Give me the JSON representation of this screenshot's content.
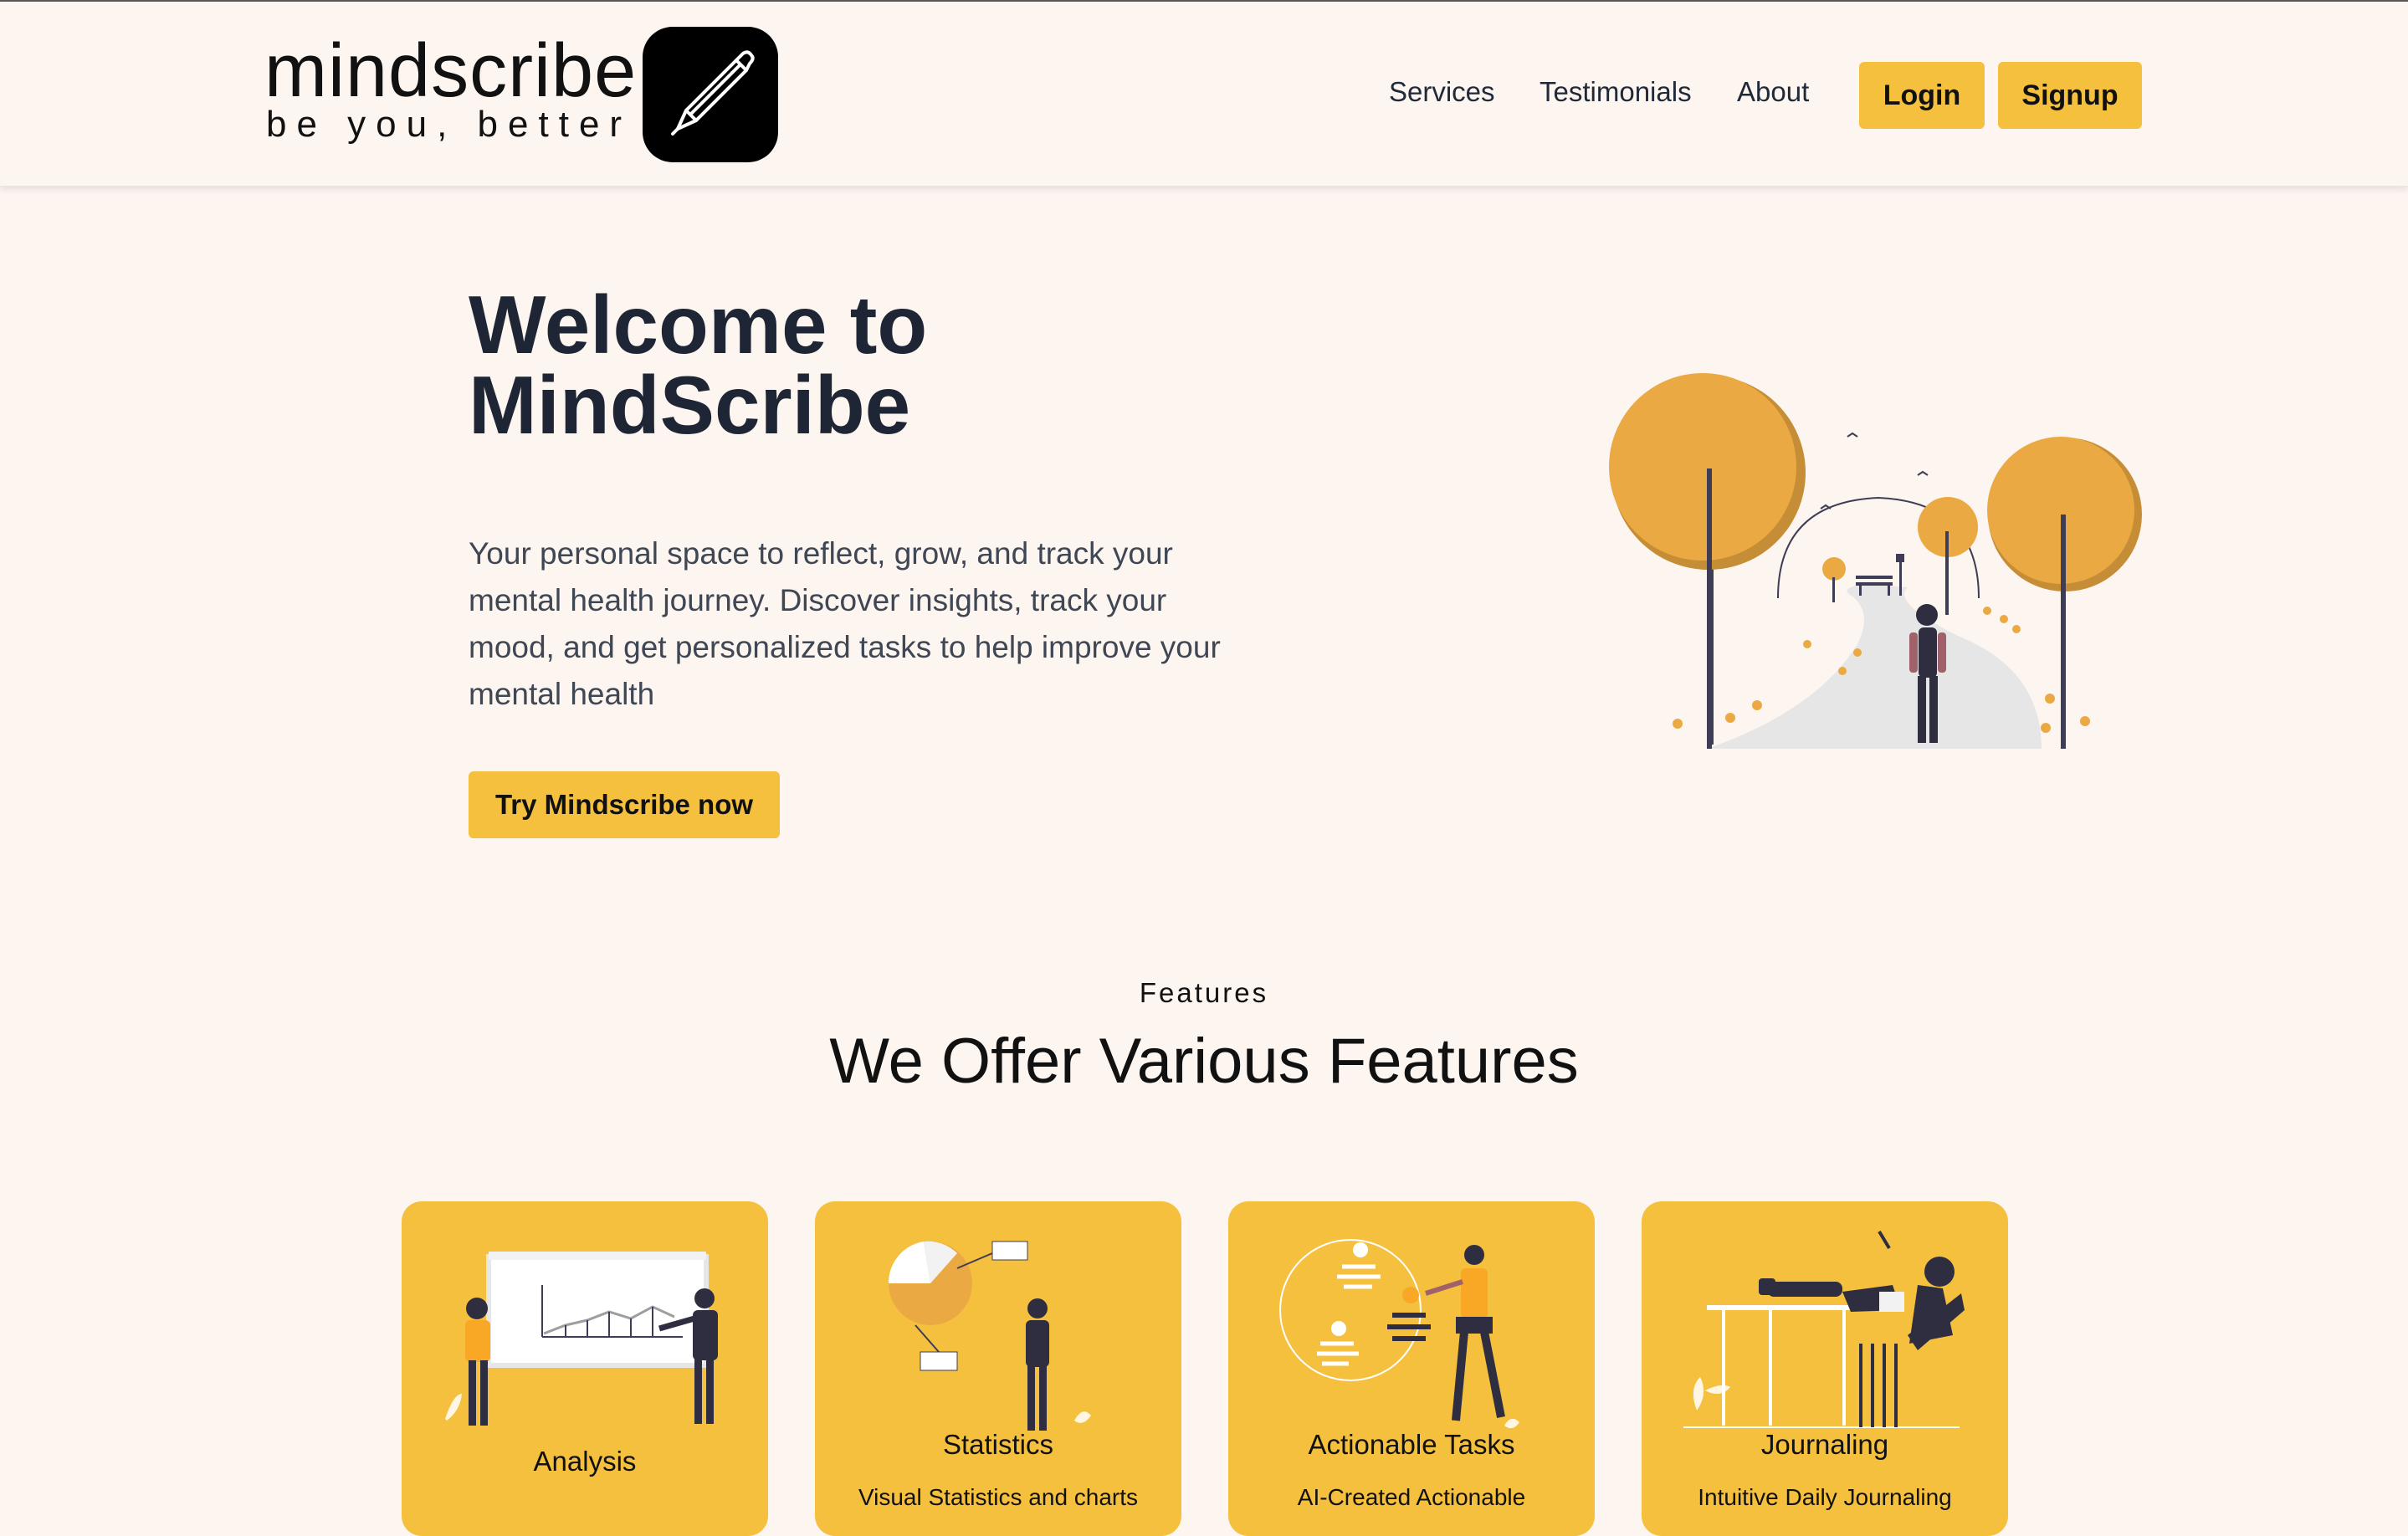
{
  "brand": {
    "wordmark": "mindscribe",
    "tagline": "be you, better",
    "logo_icon": "pen-icon"
  },
  "nav": {
    "links": [
      {
        "label": "Services"
      },
      {
        "label": "Testimonials"
      },
      {
        "label": "About"
      }
    ],
    "login_label": "Login",
    "signup_label": "Signup"
  },
  "hero": {
    "title": "Welcome to MindScribe",
    "description": "Your personal space to reflect, grow, and track your mental health journey. Discover insights, track your mood, and get personalized tasks to help improve your mental health",
    "cta_label": "Try Mindscribe now"
  },
  "features": {
    "kicker": "Features",
    "heading": "We Offer Various Features",
    "cards": [
      {
        "title": "Analysis",
        "description": ""
      },
      {
        "title": "Statistics",
        "description": "Visual Statistics and charts"
      },
      {
        "title": "Actionable Tasks",
        "description": "AI-Created Actionable"
      },
      {
        "title": "Journaling",
        "description": "Intuitive Daily Journaling"
      }
    ]
  },
  "colors": {
    "accent": "#f5c03e",
    "background": "#fdf5f0",
    "heading": "#1e2635",
    "tree": "#eba944"
  }
}
